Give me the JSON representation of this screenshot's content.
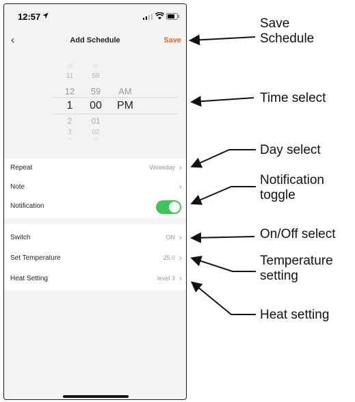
{
  "status_bar": {
    "time": "12:57"
  },
  "nav": {
    "title": "Add Schedule",
    "save_label": "Save",
    "back_icon": "chevron-left-icon"
  },
  "picker": {
    "hours": [
      "10",
      "11",
      "12",
      "1",
      "2",
      "3",
      "4"
    ],
    "minutes": [
      "57",
      "58",
      "59",
      "00",
      "01",
      "02",
      "03"
    ],
    "ampm": [
      "AM",
      "PM"
    ],
    "selected": {
      "hour": "1",
      "minute": "00",
      "ampm": "PM"
    }
  },
  "settings": {
    "repeat": {
      "label": "Repeat",
      "value": "Weekday"
    },
    "note": {
      "label": "Note",
      "value": ""
    },
    "notification": {
      "label": "Notification",
      "enabled": true
    },
    "switch": {
      "label": "Switch",
      "value": "ON"
    },
    "set_temperature": {
      "label": "Set Temperature",
      "value": "25.0"
    },
    "heat_setting": {
      "label": "Heat Setting",
      "value": "level 3"
    }
  },
  "callouts": {
    "save_line1": "Save",
    "save_line2": "Schedule",
    "time_select": "Time select",
    "day_select": "Day select",
    "notification_line1": "Notification",
    "notification_line2": "toggle",
    "onoff_select": "On/Off select",
    "temperature_line1": "Temperature",
    "temperature_line2": "setting",
    "heat_setting": "Heat setting"
  },
  "colors": {
    "accent": "#e8662b",
    "toggle_on": "#3fc45a",
    "background": "#f3f3f3"
  }
}
